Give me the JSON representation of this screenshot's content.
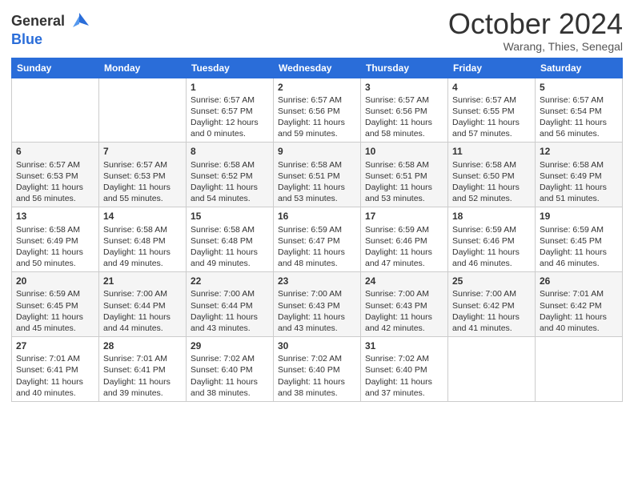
{
  "logo": {
    "general": "General",
    "blue": "Blue"
  },
  "header": {
    "title": "October 2024",
    "location": "Warang, Thies, Senegal"
  },
  "columns": [
    "Sunday",
    "Monday",
    "Tuesday",
    "Wednesday",
    "Thursday",
    "Friday",
    "Saturday"
  ],
  "weeks": [
    [
      {
        "day": "",
        "sunrise": "",
        "sunset": "",
        "daylight": ""
      },
      {
        "day": "",
        "sunrise": "",
        "sunset": "",
        "daylight": ""
      },
      {
        "day": "1",
        "sunrise": "Sunrise: 6:57 AM",
        "sunset": "Sunset: 6:57 PM",
        "daylight": "Daylight: 12 hours and 0 minutes."
      },
      {
        "day": "2",
        "sunrise": "Sunrise: 6:57 AM",
        "sunset": "Sunset: 6:56 PM",
        "daylight": "Daylight: 11 hours and 59 minutes."
      },
      {
        "day": "3",
        "sunrise": "Sunrise: 6:57 AM",
        "sunset": "Sunset: 6:56 PM",
        "daylight": "Daylight: 11 hours and 58 minutes."
      },
      {
        "day": "4",
        "sunrise": "Sunrise: 6:57 AM",
        "sunset": "Sunset: 6:55 PM",
        "daylight": "Daylight: 11 hours and 57 minutes."
      },
      {
        "day": "5",
        "sunrise": "Sunrise: 6:57 AM",
        "sunset": "Sunset: 6:54 PM",
        "daylight": "Daylight: 11 hours and 56 minutes."
      }
    ],
    [
      {
        "day": "6",
        "sunrise": "Sunrise: 6:57 AM",
        "sunset": "Sunset: 6:53 PM",
        "daylight": "Daylight: 11 hours and 56 minutes."
      },
      {
        "day": "7",
        "sunrise": "Sunrise: 6:57 AM",
        "sunset": "Sunset: 6:53 PM",
        "daylight": "Daylight: 11 hours and 55 minutes."
      },
      {
        "day": "8",
        "sunrise": "Sunrise: 6:58 AM",
        "sunset": "Sunset: 6:52 PM",
        "daylight": "Daylight: 11 hours and 54 minutes."
      },
      {
        "day": "9",
        "sunrise": "Sunrise: 6:58 AM",
        "sunset": "Sunset: 6:51 PM",
        "daylight": "Daylight: 11 hours and 53 minutes."
      },
      {
        "day": "10",
        "sunrise": "Sunrise: 6:58 AM",
        "sunset": "Sunset: 6:51 PM",
        "daylight": "Daylight: 11 hours and 53 minutes."
      },
      {
        "day": "11",
        "sunrise": "Sunrise: 6:58 AM",
        "sunset": "Sunset: 6:50 PM",
        "daylight": "Daylight: 11 hours and 52 minutes."
      },
      {
        "day": "12",
        "sunrise": "Sunrise: 6:58 AM",
        "sunset": "Sunset: 6:49 PM",
        "daylight": "Daylight: 11 hours and 51 minutes."
      }
    ],
    [
      {
        "day": "13",
        "sunrise": "Sunrise: 6:58 AM",
        "sunset": "Sunset: 6:49 PM",
        "daylight": "Daylight: 11 hours and 50 minutes."
      },
      {
        "day": "14",
        "sunrise": "Sunrise: 6:58 AM",
        "sunset": "Sunset: 6:48 PM",
        "daylight": "Daylight: 11 hours and 49 minutes."
      },
      {
        "day": "15",
        "sunrise": "Sunrise: 6:58 AM",
        "sunset": "Sunset: 6:48 PM",
        "daylight": "Daylight: 11 hours and 49 minutes."
      },
      {
        "day": "16",
        "sunrise": "Sunrise: 6:59 AM",
        "sunset": "Sunset: 6:47 PM",
        "daylight": "Daylight: 11 hours and 48 minutes."
      },
      {
        "day": "17",
        "sunrise": "Sunrise: 6:59 AM",
        "sunset": "Sunset: 6:46 PM",
        "daylight": "Daylight: 11 hours and 47 minutes."
      },
      {
        "day": "18",
        "sunrise": "Sunrise: 6:59 AM",
        "sunset": "Sunset: 6:46 PM",
        "daylight": "Daylight: 11 hours and 46 minutes."
      },
      {
        "day": "19",
        "sunrise": "Sunrise: 6:59 AM",
        "sunset": "Sunset: 6:45 PM",
        "daylight": "Daylight: 11 hours and 46 minutes."
      }
    ],
    [
      {
        "day": "20",
        "sunrise": "Sunrise: 6:59 AM",
        "sunset": "Sunset: 6:45 PM",
        "daylight": "Daylight: 11 hours and 45 minutes."
      },
      {
        "day": "21",
        "sunrise": "Sunrise: 7:00 AM",
        "sunset": "Sunset: 6:44 PM",
        "daylight": "Daylight: 11 hours and 44 minutes."
      },
      {
        "day": "22",
        "sunrise": "Sunrise: 7:00 AM",
        "sunset": "Sunset: 6:44 PM",
        "daylight": "Daylight: 11 hours and 43 minutes."
      },
      {
        "day": "23",
        "sunrise": "Sunrise: 7:00 AM",
        "sunset": "Sunset: 6:43 PM",
        "daylight": "Daylight: 11 hours and 43 minutes."
      },
      {
        "day": "24",
        "sunrise": "Sunrise: 7:00 AM",
        "sunset": "Sunset: 6:43 PM",
        "daylight": "Daylight: 11 hours and 42 minutes."
      },
      {
        "day": "25",
        "sunrise": "Sunrise: 7:00 AM",
        "sunset": "Sunset: 6:42 PM",
        "daylight": "Daylight: 11 hours and 41 minutes."
      },
      {
        "day": "26",
        "sunrise": "Sunrise: 7:01 AM",
        "sunset": "Sunset: 6:42 PM",
        "daylight": "Daylight: 11 hours and 40 minutes."
      }
    ],
    [
      {
        "day": "27",
        "sunrise": "Sunrise: 7:01 AM",
        "sunset": "Sunset: 6:41 PM",
        "daylight": "Daylight: 11 hours and 40 minutes."
      },
      {
        "day": "28",
        "sunrise": "Sunrise: 7:01 AM",
        "sunset": "Sunset: 6:41 PM",
        "daylight": "Daylight: 11 hours and 39 minutes."
      },
      {
        "day": "29",
        "sunrise": "Sunrise: 7:02 AM",
        "sunset": "Sunset: 6:40 PM",
        "daylight": "Daylight: 11 hours and 38 minutes."
      },
      {
        "day": "30",
        "sunrise": "Sunrise: 7:02 AM",
        "sunset": "Sunset: 6:40 PM",
        "daylight": "Daylight: 11 hours and 38 minutes."
      },
      {
        "day": "31",
        "sunrise": "Sunrise: 7:02 AM",
        "sunset": "Sunset: 6:40 PM",
        "daylight": "Daylight: 11 hours and 37 minutes."
      },
      {
        "day": "",
        "sunrise": "",
        "sunset": "",
        "daylight": ""
      },
      {
        "day": "",
        "sunrise": "",
        "sunset": "",
        "daylight": ""
      }
    ]
  ]
}
